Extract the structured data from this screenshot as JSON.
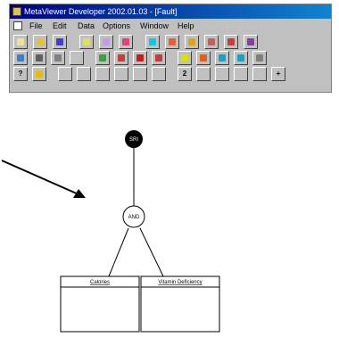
{
  "window": {
    "title": "MetaViewer Developer 2002.01.03 - [Fault]"
  },
  "menu": {
    "items": [
      "File",
      "Edit",
      "Data",
      "Options",
      "Window",
      "Help"
    ]
  },
  "toolbar1": [
    {
      "name": "new-icon",
      "color": "#f0e0a0"
    },
    {
      "name": "open-folder-icon",
      "color": "#e0c040"
    },
    {
      "name": "save-icon",
      "color": "#4040c0"
    },
    {
      "name": "copy-icon",
      "color": "#e0e060"
    },
    {
      "name": "paste-icon",
      "color": "#c0a0e0"
    },
    {
      "name": "cut-icon",
      "color": "#e04080"
    },
    {
      "name": "info-icon",
      "color": "#20c0e0"
    },
    {
      "name": "gate-icon",
      "color": "#e06040"
    },
    {
      "name": "event-icon",
      "color": "#e0a020"
    },
    {
      "name": "link-icon",
      "color": "#c06060"
    },
    {
      "name": "help-icon",
      "color": "#c04040"
    },
    {
      "name": "pointer-icon",
      "color": "#8040a0"
    }
  ],
  "toolbar2": [
    {
      "name": "zoom-icon",
      "color": "#4080c0"
    },
    {
      "name": "search-icon",
      "color": "#606060"
    },
    {
      "name": "find-icon",
      "color": "#808080"
    },
    {
      "name": "blank-icon",
      "color": "#c0c0c0"
    },
    {
      "name": "run-icon",
      "color": "#40a040"
    },
    {
      "name": "stop-icon",
      "color": "#c04040"
    },
    {
      "name": "delete-icon",
      "color": "#c02020"
    },
    {
      "name": "arrow-left-icon",
      "color": "#c04040"
    },
    {
      "name": "light-icon",
      "color": "#e0e000"
    },
    {
      "name": "chart-icon",
      "color": "#e06020"
    },
    {
      "name": "table-icon",
      "color": "#20a0c0"
    },
    {
      "name": "grid-icon",
      "color": "#20a0c0"
    },
    {
      "name": "export-icon",
      "color": "#808080"
    }
  ],
  "toolbar3": [
    {
      "name": "question-icon",
      "color": "#e04040",
      "text": "?"
    },
    {
      "name": "bulb-icon",
      "color": "#e0c000"
    },
    {
      "name": "box-a-icon",
      "color": "#c0c0c0"
    },
    {
      "name": "box-b-icon",
      "color": "#c0c0c0"
    },
    {
      "name": "box-c-icon",
      "color": "#c0c0c0"
    },
    {
      "name": "box-d-icon",
      "color": "#c0c0c0"
    },
    {
      "name": "box-e-icon",
      "color": "#c0c0c0"
    },
    {
      "name": "box-f-icon",
      "color": "#c0c0c0"
    },
    {
      "name": "number-two-icon",
      "color": "#c0c0c0",
      "text": "2"
    },
    {
      "name": "wave-icon",
      "color": "#c0c0c0"
    },
    {
      "name": "curve-icon",
      "color": "#c0c0c0"
    },
    {
      "name": "arrow-icon",
      "color": "#c0c0c0"
    },
    {
      "name": "blank2-icon",
      "color": "#c0c0c0"
    },
    {
      "name": "cross-icon",
      "color": "#202020",
      "text": "+"
    }
  ],
  "diagram": {
    "top_node": "SRI",
    "gate_node": "AND",
    "left_box": "Calories",
    "right_box": "Vitamin Deficiency"
  }
}
